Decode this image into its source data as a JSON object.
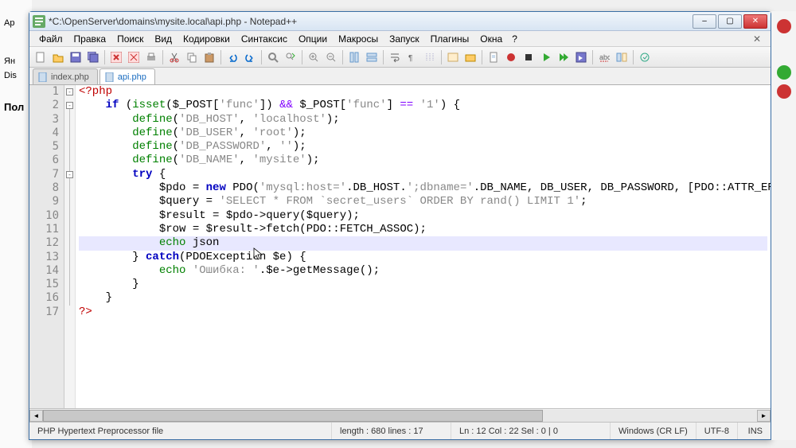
{
  "outer": {
    "left_items": [
      "Ap",
      "Ян",
      "Dis"
    ],
    "bottom_label": "Пол"
  },
  "window": {
    "title": "*C:\\OpenServer\\domains\\mysite.local\\api.php - Notepad++"
  },
  "menu": {
    "items": [
      "Файл",
      "Правка",
      "Поиск",
      "Вид",
      "Кодировки",
      "Синтаксис",
      "Опции",
      "Макросы",
      "Запуск",
      "Плагины",
      "Окна",
      "?"
    ]
  },
  "tabs": {
    "items": [
      {
        "label": "index.php",
        "active": false
      },
      {
        "label": "api.php",
        "active": true
      }
    ]
  },
  "code": {
    "lines": [
      {
        "n": 1,
        "segments": [
          {
            "t": "<?php",
            "c": "tag"
          }
        ]
      },
      {
        "n": 2,
        "segments": [
          {
            "t": "    ",
            "c": ""
          },
          {
            "t": "if",
            "c": "kw"
          },
          {
            "t": " (",
            "c": ""
          },
          {
            "t": "isset",
            "c": "kw2"
          },
          {
            "t": "(",
            "c": ""
          },
          {
            "t": "$_POST",
            "c": "var"
          },
          {
            "t": "[",
            "c": ""
          },
          {
            "t": "'func'",
            "c": "str"
          },
          {
            "t": "]) ",
            "c": ""
          },
          {
            "t": "&&",
            "c": "op"
          },
          {
            "t": " ",
            "c": ""
          },
          {
            "t": "$_POST",
            "c": "var"
          },
          {
            "t": "[",
            "c": ""
          },
          {
            "t": "'func'",
            "c": "str"
          },
          {
            "t": "] ",
            "c": ""
          },
          {
            "t": "==",
            "c": "op"
          },
          {
            "t": " ",
            "c": ""
          },
          {
            "t": "'1'",
            "c": "str"
          },
          {
            "t": ") {",
            "c": ""
          }
        ]
      },
      {
        "n": 3,
        "segments": [
          {
            "t": "        ",
            "c": ""
          },
          {
            "t": "define",
            "c": "kw2"
          },
          {
            "t": "(",
            "c": ""
          },
          {
            "t": "'DB_HOST'",
            "c": "str"
          },
          {
            "t": ", ",
            "c": ""
          },
          {
            "t": "'localhost'",
            "c": "str"
          },
          {
            "t": ");",
            "c": ""
          }
        ]
      },
      {
        "n": 4,
        "segments": [
          {
            "t": "        ",
            "c": ""
          },
          {
            "t": "define",
            "c": "kw2"
          },
          {
            "t": "(",
            "c": ""
          },
          {
            "t": "'DB_USER'",
            "c": "str"
          },
          {
            "t": ", ",
            "c": ""
          },
          {
            "t": "'root'",
            "c": "str"
          },
          {
            "t": ");",
            "c": ""
          }
        ]
      },
      {
        "n": 5,
        "segments": [
          {
            "t": "        ",
            "c": ""
          },
          {
            "t": "define",
            "c": "kw2"
          },
          {
            "t": "(",
            "c": ""
          },
          {
            "t": "'DB_PASSWORD'",
            "c": "str"
          },
          {
            "t": ", ",
            "c": ""
          },
          {
            "t": "''",
            "c": "str"
          },
          {
            "t": ");",
            "c": ""
          }
        ]
      },
      {
        "n": 6,
        "segments": [
          {
            "t": "        ",
            "c": ""
          },
          {
            "t": "define",
            "c": "kw2"
          },
          {
            "t": "(",
            "c": ""
          },
          {
            "t": "'DB_NAME'",
            "c": "str"
          },
          {
            "t": ", ",
            "c": ""
          },
          {
            "t": "'mysite'",
            "c": "str"
          },
          {
            "t": ");",
            "c": ""
          }
        ]
      },
      {
        "n": 7,
        "segments": [
          {
            "t": "        ",
            "c": ""
          },
          {
            "t": "try",
            "c": "kw"
          },
          {
            "t": " {",
            "c": ""
          }
        ]
      },
      {
        "n": 8,
        "segments": [
          {
            "t": "            ",
            "c": ""
          },
          {
            "t": "$pdo",
            "c": "var"
          },
          {
            "t": " = ",
            "c": ""
          },
          {
            "t": "new",
            "c": "kw"
          },
          {
            "t": " PDO(",
            "c": ""
          },
          {
            "t": "'mysql:host='",
            "c": "str"
          },
          {
            "t": ".DB_HOST.",
            "c": ""
          },
          {
            "t": "';dbname='",
            "c": "str"
          },
          {
            "t": ".DB_NAME, DB_USER, DB_PASSWORD, [PDO::ATTR_ERRMODE =",
            "c": ""
          }
        ]
      },
      {
        "n": 9,
        "segments": [
          {
            "t": "            ",
            "c": ""
          },
          {
            "t": "$query",
            "c": "var"
          },
          {
            "t": " = ",
            "c": ""
          },
          {
            "t": "'SELECT * FROM `secret_users` ORDER BY rand() LIMIT 1'",
            "c": "str"
          },
          {
            "t": ";",
            "c": ""
          }
        ]
      },
      {
        "n": 10,
        "segments": [
          {
            "t": "            ",
            "c": ""
          },
          {
            "t": "$result",
            "c": "var"
          },
          {
            "t": " = ",
            "c": ""
          },
          {
            "t": "$pdo",
            "c": "var"
          },
          {
            "t": "->",
            "c": ""
          },
          {
            "t": "query",
            "c": "func"
          },
          {
            "t": "(",
            "c": ""
          },
          {
            "t": "$query",
            "c": "var"
          },
          {
            "t": ");",
            "c": ""
          }
        ]
      },
      {
        "n": 11,
        "segments": [
          {
            "t": "            ",
            "c": ""
          },
          {
            "t": "$row",
            "c": "var"
          },
          {
            "t": " = ",
            "c": ""
          },
          {
            "t": "$result",
            "c": "var"
          },
          {
            "t": "->",
            "c": ""
          },
          {
            "t": "fetch",
            "c": "func"
          },
          {
            "t": "(PDO::FETCH_ASSOC);",
            "c": ""
          }
        ]
      },
      {
        "n": 12,
        "hl": true,
        "segments": [
          {
            "t": "            ",
            "c": ""
          },
          {
            "t": "echo",
            "c": "kw2"
          },
          {
            "t": " json",
            "c": ""
          }
        ]
      },
      {
        "n": 13,
        "segments": [
          {
            "t": "        } ",
            "c": ""
          },
          {
            "t": "catch",
            "c": "kw"
          },
          {
            "t": "(PDOException ",
            "c": ""
          },
          {
            "t": "$e",
            "c": "var"
          },
          {
            "t": ") {",
            "c": ""
          }
        ]
      },
      {
        "n": 14,
        "segments": [
          {
            "t": "            ",
            "c": ""
          },
          {
            "t": "echo",
            "c": "kw2"
          },
          {
            "t": " ",
            "c": ""
          },
          {
            "t": "'Ошибка: '",
            "c": "str"
          },
          {
            "t": ".",
            "c": ""
          },
          {
            "t": "$e",
            "c": "var"
          },
          {
            "t": "->",
            "c": ""
          },
          {
            "t": "getMessage",
            "c": "func"
          },
          {
            "t": "();",
            "c": ""
          }
        ]
      },
      {
        "n": 15,
        "segments": [
          {
            "t": "        }",
            "c": ""
          }
        ]
      },
      {
        "n": 16,
        "segments": [
          {
            "t": "    }",
            "c": ""
          }
        ]
      },
      {
        "n": 17,
        "segments": [
          {
            "t": "?>",
            "c": "tag"
          }
        ]
      }
    ]
  },
  "status": {
    "filetype": "PHP Hypertext Preprocessor file",
    "length": "length : 680    lines : 17",
    "pos": "Ln : 12    Col : 22    Sel : 0 | 0",
    "eol": "Windows (CR LF)",
    "enc": "UTF-8",
    "mode": "INS"
  },
  "right_buttons": [
    {
      "color": "#c33"
    },
    {
      "color": "#3a3"
    },
    {
      "color": "#c33"
    }
  ]
}
